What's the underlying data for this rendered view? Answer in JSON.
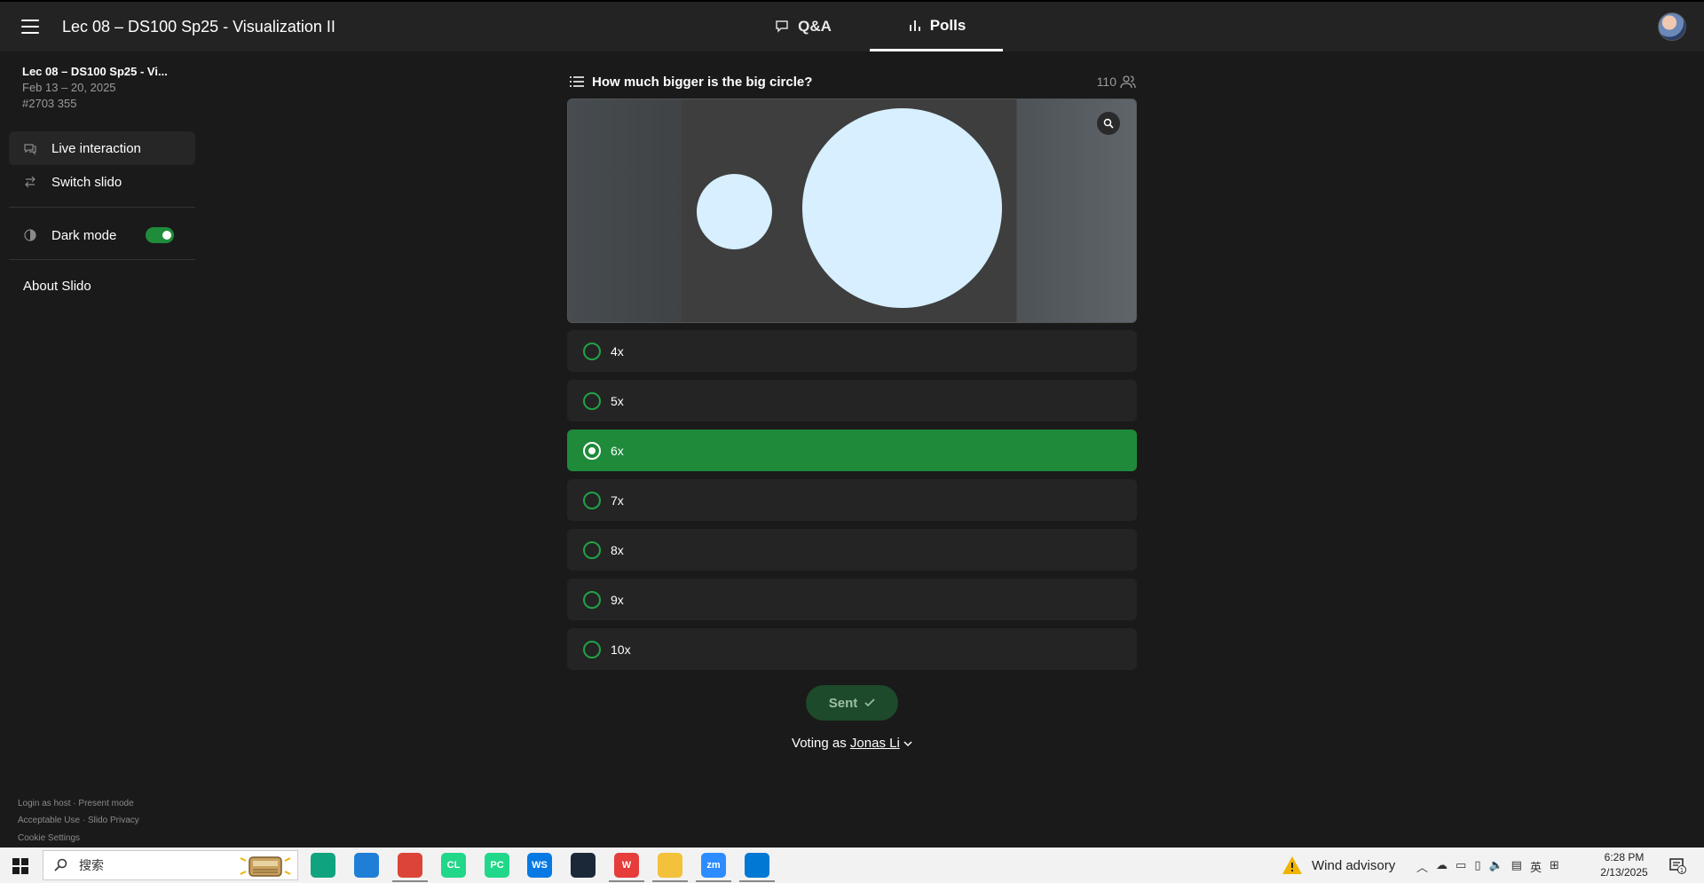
{
  "header": {
    "event_title": "Lec 08 – DS100 Sp25 - Visualization II",
    "tabs": [
      {
        "label": "Q&A",
        "icon": "chat-bubble-icon"
      },
      {
        "label": "Polls",
        "icon": "bar-chart-icon"
      }
    ],
    "active_tab": "Polls"
  },
  "sidebar": {
    "event_name": "Lec 08 – DS100 Sp25 - Vi...",
    "event_dates": "Feb 13 – 20, 2025",
    "event_code": "#2703 355",
    "items": [
      {
        "label": "Live interaction",
        "icon": "chat-icon"
      },
      {
        "label": "Switch slido",
        "icon": "switch-arrows-icon"
      }
    ],
    "dark_mode_label": "Dark mode",
    "dark_mode_on": true,
    "about_label": "About Slido",
    "footer": {
      "login_host": "Login as host",
      "present_mode": "Present mode",
      "acceptable_use": "Acceptable Use",
      "privacy": "Slido Privacy",
      "cookies": "Cookie Settings",
      "sep": "·"
    }
  },
  "poll": {
    "question": "How much bigger is the big circle?",
    "participants": "110",
    "options": [
      "4x",
      "5x",
      "6x",
      "7x",
      "8x",
      "9x",
      "10x"
    ],
    "selected_index": 2,
    "submit_label": "Sent",
    "voting_as_prefix": "Voting as",
    "voter_name": "Jonas Li"
  },
  "taskbar": {
    "search_placeholder": "搜索",
    "weather_text": "Wind advisory",
    "tray_lang": "英",
    "time": "6:28 PM",
    "date": "2/13/2025",
    "notification_count": "1",
    "apps": [
      {
        "name": "chatgpt-app",
        "label": "",
        "color": "#10a37f"
      },
      {
        "name": "edge-app",
        "label": "",
        "color": "#1f7fd6"
      },
      {
        "name": "chrome-app",
        "label": "",
        "color": "#db4437"
      },
      {
        "name": "clion-app",
        "label": "CL",
        "color": "#21d789"
      },
      {
        "name": "pycharm-app",
        "label": "PC",
        "color": "#21d789"
      },
      {
        "name": "webstorm-app",
        "label": "WS",
        "color": "#0779e4"
      },
      {
        "name": "steam-app",
        "label": "",
        "color": "#1b2838"
      },
      {
        "name": "wps-app",
        "label": "W",
        "color": "#e63c3c"
      },
      {
        "name": "explorer-app",
        "label": "",
        "color": "#f3c13a"
      },
      {
        "name": "zoom-app",
        "label": "zm",
        "color": "#2d8cff"
      },
      {
        "name": "vscode-app",
        "label": "",
        "color": "#0078d4"
      }
    ]
  },
  "colors": {
    "accent": "#1e8a3a",
    "background": "#1a1a1a",
    "circle": "#d7efff"
  }
}
